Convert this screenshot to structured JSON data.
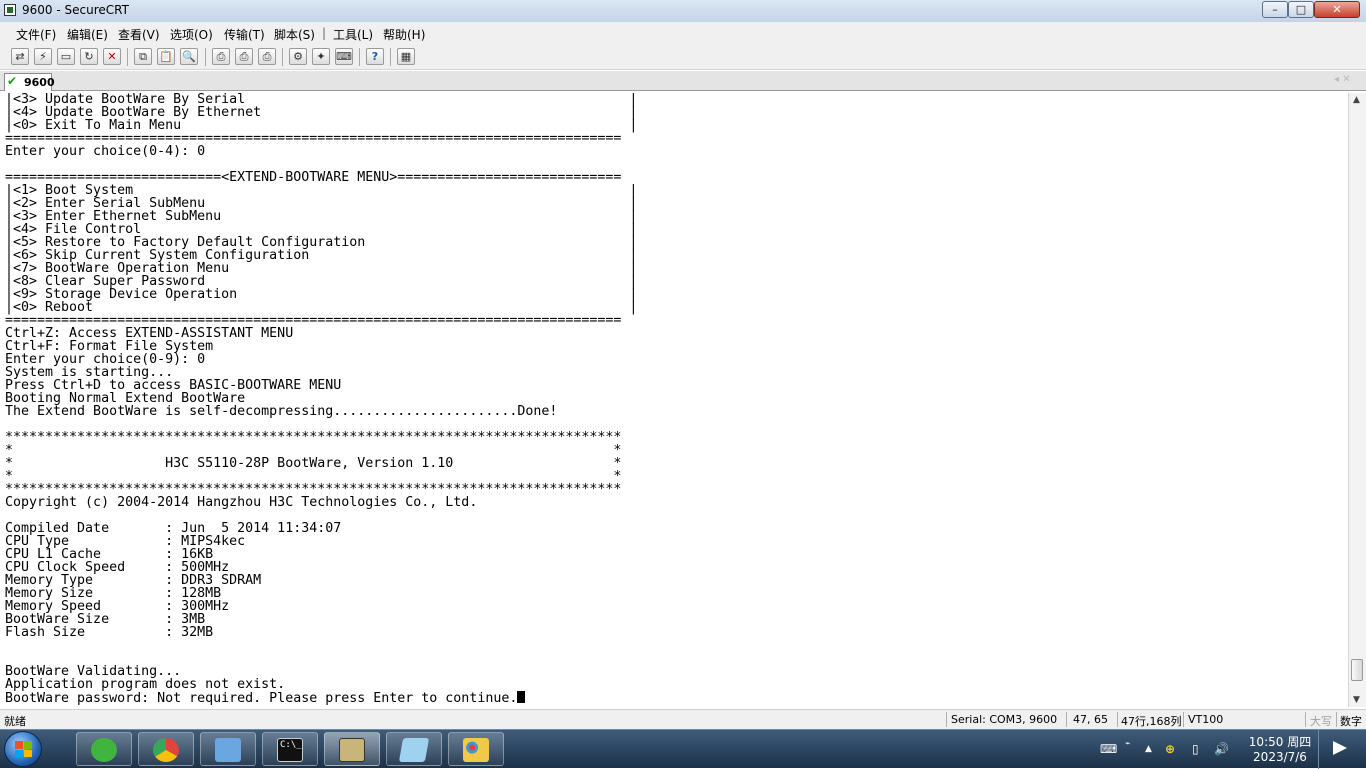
{
  "window": {
    "title": "9600 - SecureCRT",
    "controls": {
      "minimize": "–",
      "maximize": "□",
      "close": "✕"
    }
  },
  "menu": [
    {
      "label": "文件(F)"
    },
    {
      "label": "编辑(E)"
    },
    {
      "label": "查看(V)"
    },
    {
      "label": "选项(O)"
    },
    {
      "label": "传输(T)"
    },
    {
      "label": "脚本(S)"
    },
    {
      "label": "工具(L)"
    },
    {
      "label": "帮助(H)"
    }
  ],
  "toolbar": {
    "icons": [
      "connect-icon",
      "quick-connect-icon",
      "connect-in-tab-icon",
      "reconnect-icon",
      "disconnect-icon",
      "copy-icon",
      "paste-icon",
      "find-icon",
      "print-icon",
      "print-selection-icon",
      "print-setup-icon",
      "session-options-icon",
      "global-options-icon",
      "keymap-icon",
      "help-icon",
      "sftp-icon"
    ],
    "glyphs": {
      "connect-icon": "⇄",
      "quick-connect-icon": "⚡",
      "connect-in-tab-icon": "▭",
      "reconnect-icon": "↻",
      "disconnect-icon": "✕",
      "copy-icon": "⧉",
      "paste-icon": "📋",
      "find-icon": "🔍",
      "print-icon": "⎙",
      "print-selection-icon": "⎙",
      "print-setup-icon": "⎙",
      "session-options-icon": "⚙",
      "global-options-icon": "✦",
      "keymap-icon": "⌨",
      "help-icon": "?",
      "sftp-icon": "▦"
    }
  },
  "tabs": [
    {
      "label": "9600",
      "status": "connected"
    }
  ],
  "terminal": {
    "lines": [
      "|<3> Update BootWare By Serial                                                |",
      "|<4> Update BootWare By Ethernet                                              |",
      "|<0> Exit To Main Menu                                                        |",
      "=============================================================================",
      "Enter your choice(0-4): 0",
      "",
      "===========================<EXTEND-BOOTWARE MENU>============================",
      "|<1> Boot System                                                              |",
      "|<2> Enter Serial SubMenu                                                     |",
      "|<3> Enter Ethernet SubMenu                                                   |",
      "|<4> File Control                                                             |",
      "|<5> Restore to Factory Default Configuration                                 |",
      "|<6> Skip Current System Configuration                                        |",
      "|<7> BootWare Operation Menu                                                  |",
      "|<8> Clear Super Password                                                     |",
      "|<9> Storage Device Operation                                                 |",
      "|<0> Reboot                                                                   |",
      "=============================================================================",
      "Ctrl+Z: Access EXTEND-ASSISTANT MENU",
      "Ctrl+F: Format File System",
      "Enter your choice(0-9): 0",
      "System is starting...",
      "Press Ctrl+D to access BASIC-BOOTWARE MENU",
      "Booting Normal Extend BootWare",
      "The Extend BootWare is self-decompressing.......................Done!",
      "",
      "*****************************************************************************",
      "*                                                                           *",
      "*                   H3C S5110-28P BootWare, Version 1.10                    *",
      "*                                                                           *",
      "*****************************************************************************",
      "Copyright (c) 2004-2014 Hangzhou H3C Technologies Co., Ltd.",
      "",
      "Compiled Date       : Jun  5 2014 11:34:07",
      "CPU Type            : MIPS4kec",
      "CPU L1 Cache        : 16KB",
      "CPU Clock Speed     : 500MHz",
      "Memory Type         : DDR3 SDRAM",
      "Memory Size         : 128MB",
      "Memory Speed        : 300MHz",
      "BootWare Size       : 3MB",
      "Flash Size          : 32MB",
      "",
      "",
      "BootWare Validating...",
      "Application program does not exist.",
      "BootWare password: Not required. Please press Enter to continue."
    ]
  },
  "status": {
    "ready": "就绪",
    "connection": "Serial: COM3, 9600",
    "cursor_pos": "47,  65",
    "size": "47行,168列",
    "emulation": "VT100",
    "caps": "大写",
    "num": "数字"
  },
  "taskbar": {
    "apps": [
      {
        "name": "taskbar-app-360-browser",
        "color": "#3fb53f"
      },
      {
        "name": "taskbar-app-chrome",
        "color": "#e0443a"
      },
      {
        "name": "taskbar-app-network",
        "color": "#6aa6e0"
      },
      {
        "name": "taskbar-app-cmd",
        "color": "#111111"
      },
      {
        "name": "taskbar-app-securecrt",
        "color": "#c9b47a"
      },
      {
        "name": "taskbar-app-notepad",
        "color": "#9fd2ee"
      },
      {
        "name": "taskbar-app-paint",
        "color": "#f2c84a"
      }
    ],
    "clock": {
      "time": "10:50 周四",
      "date": "2023/7/6"
    }
  }
}
